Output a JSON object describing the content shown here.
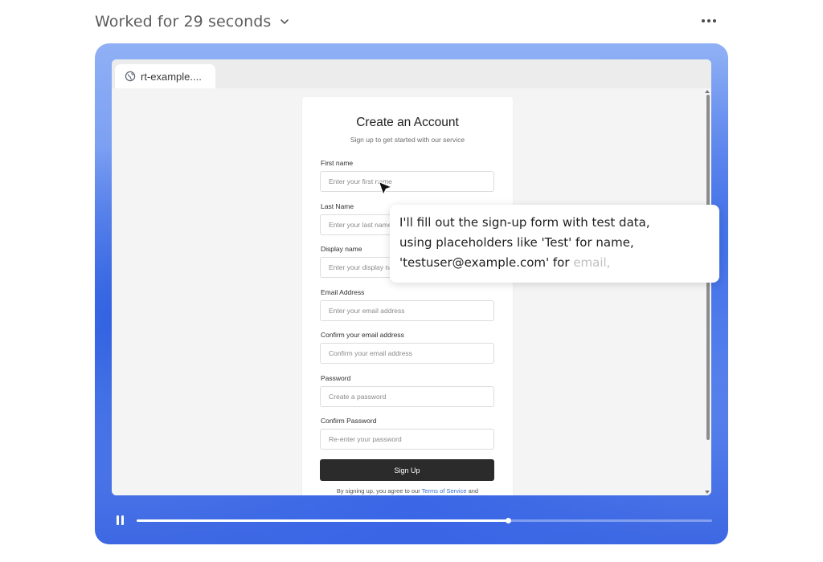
{
  "header": {
    "title": "Worked for 29 seconds",
    "chevron_icon": "chevron-down-icon",
    "more_icon": "more-horizontal-icon"
  },
  "browser": {
    "tab": {
      "label": "rt-example....",
      "icon": "globe-icon"
    }
  },
  "form": {
    "title": "Create an Account",
    "subtitle": "Sign up to get started with our service",
    "fields": [
      {
        "label": "First name",
        "placeholder": "Enter your first name"
      },
      {
        "label": "Last Name",
        "placeholder": "Enter your last name"
      },
      {
        "label": "Display name",
        "placeholder": "Enter your display name"
      },
      {
        "label": "Email Address",
        "placeholder": "Enter your email address"
      },
      {
        "label": "Confirm your email address",
        "placeholder": "Confirm your email address"
      },
      {
        "label": "Password",
        "placeholder": "Create a password"
      },
      {
        "label": "Confirm Password",
        "placeholder": "Re-enter your password"
      }
    ],
    "submit_label": "Sign Up",
    "terms_prefix": "By signing up, you agree to our ",
    "terms_link": "Terms of Service",
    "terms_suffix": " and"
  },
  "bubble": {
    "line1": "I'll fill out the sign-up form with test data,",
    "line2": "using placeholders like 'Test' for name,",
    "line3_main": "'testuser@example.com' for ",
    "line3_fade": "email,"
  },
  "player": {
    "pause_icon": "pause-icon",
    "progress": 0.645
  },
  "colors": {
    "accent": "#3b6fd8",
    "button": "#2b2b2b",
    "frame": "#5a84ec"
  }
}
